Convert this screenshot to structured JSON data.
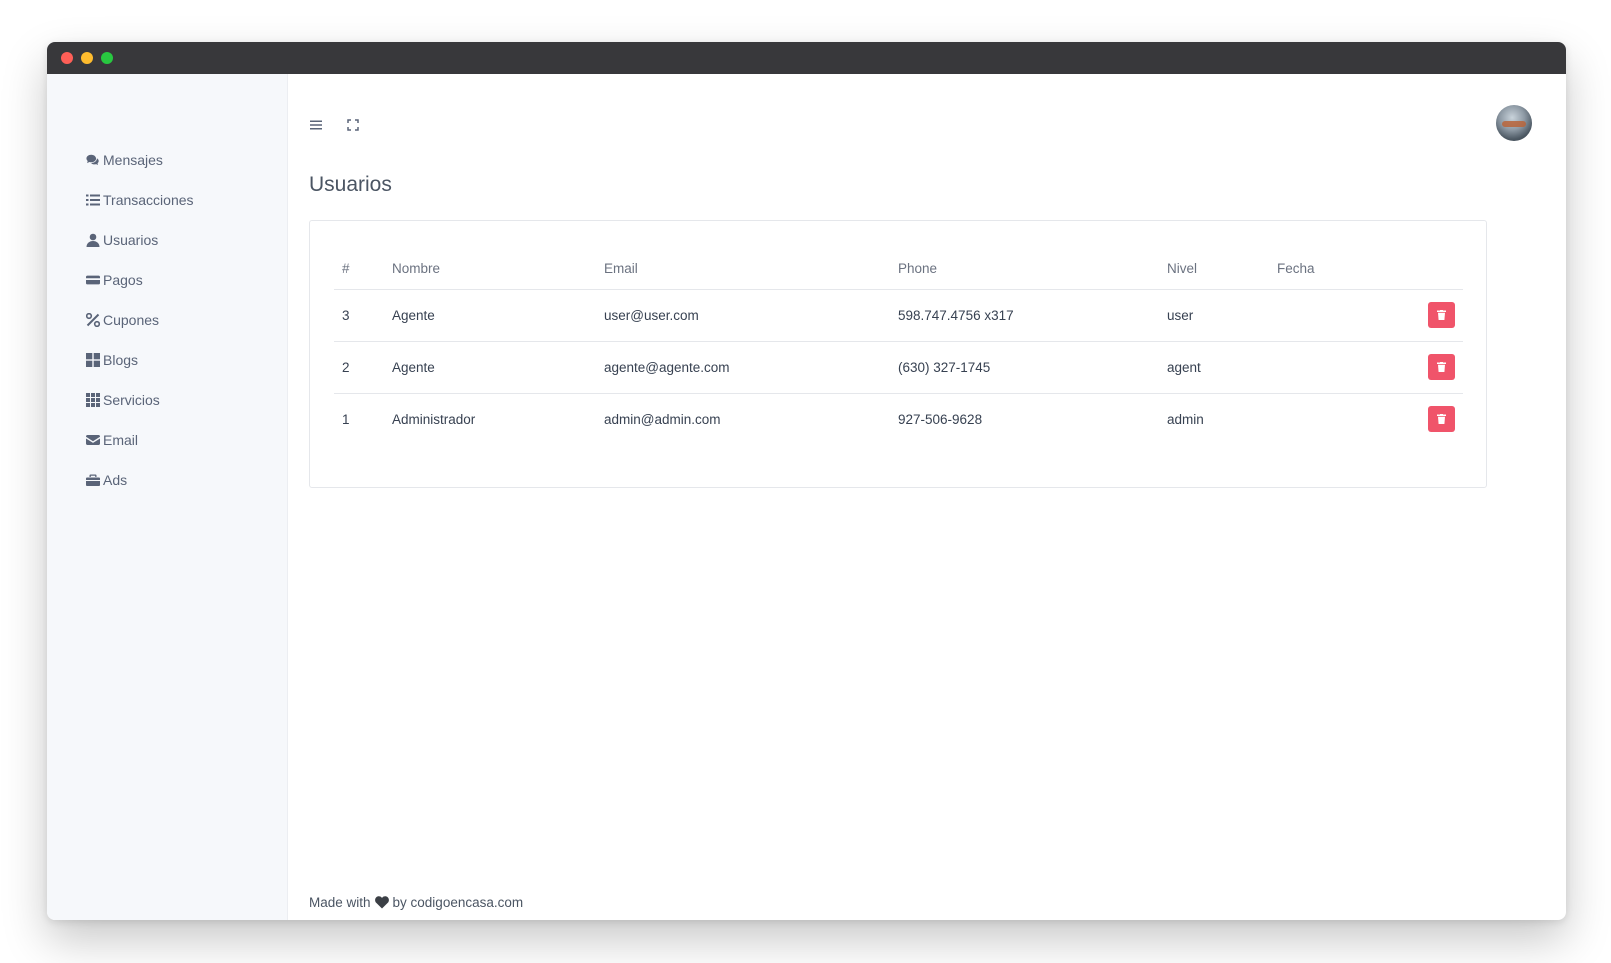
{
  "window": {
    "controls": [
      "close",
      "minimize",
      "maximize"
    ]
  },
  "sidebar": {
    "items": [
      {
        "label": "Mensajes",
        "icon": "comments-icon"
      },
      {
        "label": "Transacciones",
        "icon": "list-icon"
      },
      {
        "label": "Usuarios",
        "icon": "user-icon"
      },
      {
        "label": "Pagos",
        "icon": "credit-card-icon"
      },
      {
        "label": "Cupones",
        "icon": "percent-icon"
      },
      {
        "label": "Blogs",
        "icon": "grid-large-icon"
      },
      {
        "label": "Servicios",
        "icon": "grid-small-icon"
      },
      {
        "label": "Email",
        "icon": "envelope-icon"
      },
      {
        "label": "Ads",
        "icon": "briefcase-icon"
      }
    ]
  },
  "topbar": {
    "menu_icon": "hamburger-icon",
    "fullscreen_icon": "expand-icon",
    "avatar": "user-avatar"
  },
  "page": {
    "title": "Usuarios"
  },
  "table": {
    "headers": {
      "id": "#",
      "name": "Nombre",
      "email": "Email",
      "phone": "Phone",
      "level": "Nivel",
      "date": "Fecha"
    },
    "rows": [
      {
        "id": "3",
        "name": "Agente",
        "email": "user@user.com",
        "phone": "598.747.4756 x317",
        "level": "user",
        "date": ""
      },
      {
        "id": "2",
        "name": "Agente",
        "email": "agente@agente.com",
        "phone": "(630) 327-1745",
        "level": "agent",
        "date": ""
      },
      {
        "id": "1",
        "name": "Administrador",
        "email": "admin@admin.com",
        "phone": "927-506-9628",
        "level": "admin",
        "date": ""
      }
    ]
  },
  "footer": {
    "prefix": "Made with",
    "suffix": "by codigoencasa.com"
  },
  "colors": {
    "delete_button": "#f0546a",
    "sidebar_bg": "#f6f8fb",
    "titlebar": "#38383b"
  }
}
